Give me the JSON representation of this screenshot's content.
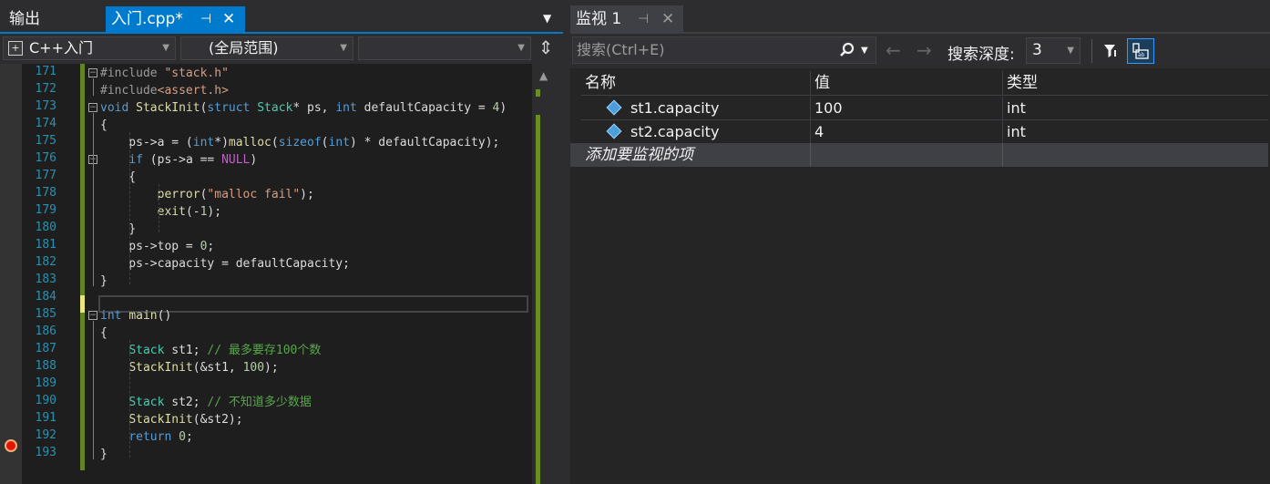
{
  "editor": {
    "tabs": {
      "output_label": "输出",
      "active_label": "入门.cpp*",
      "pin_glyph": "⊣",
      "close_glyph": "✕"
    },
    "nav": {
      "project": "C++入门",
      "scope": "(全局范围)",
      "member": ""
    },
    "lines": [
      {
        "n": "171",
        "text": "#include \"stack.h\""
      },
      {
        "n": "172",
        "text": "#include<assert.h>"
      },
      {
        "n": "173",
        "text": "void StackInit(struct Stack* ps, int defaultCapacity = 4)"
      },
      {
        "n": "174",
        "text": "{"
      },
      {
        "n": "175",
        "text": "    ps->a = (int*)malloc(sizeof(int) * defaultCapacity);"
      },
      {
        "n": "176",
        "text": "    if (ps->a == NULL)"
      },
      {
        "n": "177",
        "text": "    {"
      },
      {
        "n": "178",
        "text": "        perror(\"malloc fail\");"
      },
      {
        "n": "179",
        "text": "        exit(-1);"
      },
      {
        "n": "180",
        "text": "    }"
      },
      {
        "n": "181",
        "text": "    ps->top = 0;"
      },
      {
        "n": "182",
        "text": "    ps->capacity = defaultCapacity;"
      },
      {
        "n": "183",
        "text": "}"
      },
      {
        "n": "184",
        "text": ""
      },
      {
        "n": "185",
        "text": "int main()"
      },
      {
        "n": "186",
        "text": "{"
      },
      {
        "n": "187",
        "text": "    Stack st1; // 最多要存100个数"
      },
      {
        "n": "188",
        "text": "    StackInit(&st1, 100);"
      },
      {
        "n": "189",
        "text": ""
      },
      {
        "n": "190",
        "text": "    Stack st2; // 不知道多少数据"
      },
      {
        "n": "191",
        "text": "    StackInit(&st2);"
      },
      {
        "n": "192",
        "text": "    return 0;"
      },
      {
        "n": "193",
        "text": "}"
      }
    ],
    "colors": {
      "keyword": "#569cd6",
      "type": "#4ec9b0",
      "string": "#d69d85",
      "comment": "#57a64a",
      "function": "#dcdcaa",
      "macro": "#bd63c5",
      "member": "#dadada",
      "number": "#b5cea8",
      "preproc": "#9b9b9b"
    }
  },
  "watch": {
    "tab_label": "监视 1",
    "search_placeholder": "搜索(Ctrl+E)",
    "search_depth_label": "搜索深度:",
    "search_depth_value": "3",
    "columns": [
      "名称",
      "值",
      "类型"
    ],
    "rows": [
      {
        "name": "st1.capacity",
        "value": "100",
        "type": "int"
      },
      {
        "name": "st2.capacity",
        "value": "4",
        "type": "int"
      }
    ],
    "add_watch_label": "添加要监视的项",
    "icons": [
      "search-icon",
      "back-arrow-icon",
      "forward-arrow-icon",
      "filter-icon",
      "hex-display-icon",
      "variable-icon"
    ]
  }
}
